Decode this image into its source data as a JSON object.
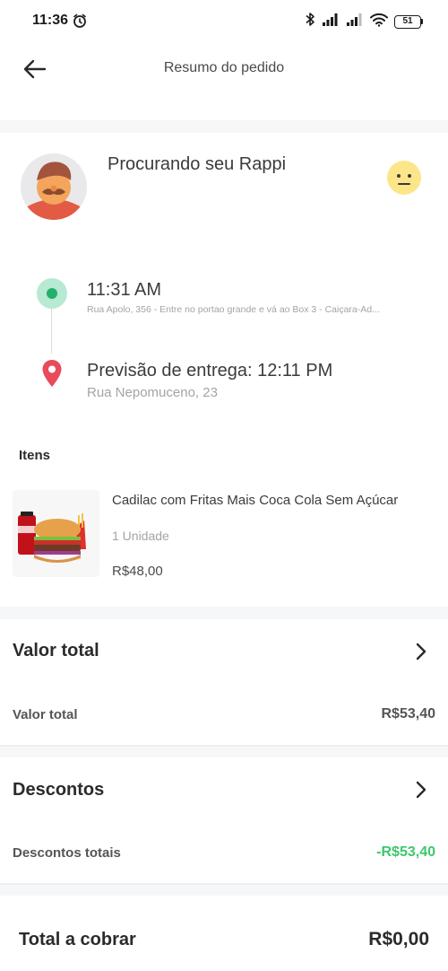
{
  "status_bar": {
    "time": "11:36",
    "battery": "51",
    "icons": [
      "alarm-icon",
      "bluetooth-icon",
      "signal-icon",
      "signal-icon",
      "wifi-icon",
      "battery-icon"
    ]
  },
  "header": {
    "title": "Resumo do pedido",
    "back_icon": "arrow-left-icon"
  },
  "courier": {
    "status": "Procurando seu Rappi",
    "mood_icon": "neutral-face-icon"
  },
  "route": {
    "pickup_time": "11:31 AM",
    "pickup_address": "Rua Apolo, 356 - Entre no portao grande e vá ao Box 3 - Caiçara-Ad...",
    "delivery_eta": "Previsão de entrega: 12:11 PM",
    "delivery_address": "Rua Nepomuceno, 23"
  },
  "items": {
    "heading": "Itens",
    "list": [
      {
        "name": "Cadilac com Fritas Mais Coca Cola Sem Açúcar",
        "quantity": "1 Unidade",
        "price": "R$48,00"
      }
    ]
  },
  "total_section": {
    "title": "Valor total",
    "row_label": "Valor total",
    "row_value": "R$53,40"
  },
  "discounts_section": {
    "title": "Descontos",
    "row_label": "Descontos totais",
    "row_value": "-R$53,40"
  },
  "charge": {
    "label": "Total a cobrar",
    "value": "R$0,00"
  },
  "colors": {
    "accent_green": "#3cc86b",
    "pickup_green": "#22b06b",
    "pin_red": "#e94a5c",
    "muted_text": "#a4a4a4"
  }
}
